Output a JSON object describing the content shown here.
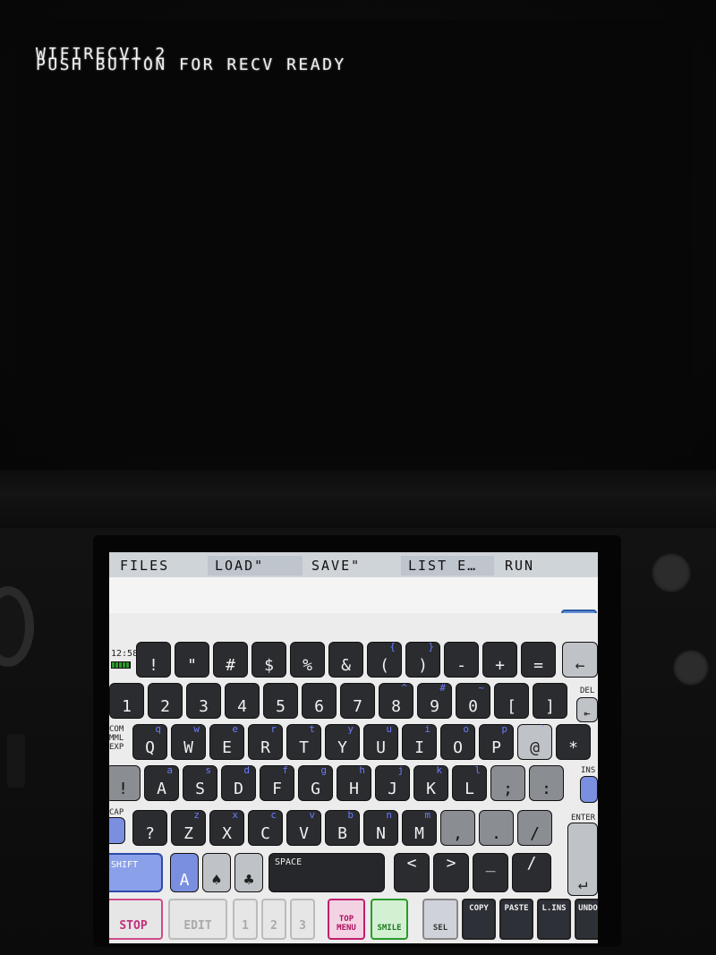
{
  "top_screen": {
    "line1": "WIFIRECV1.2",
    "line2": "PUSH BUTTON FOR RECV READY"
  },
  "menu": {
    "files": "FILES",
    "load": "LOAD\"",
    "save": "SAVE\"",
    "list": "LIST E…",
    "run": "RUN"
  },
  "status": {
    "clock": "12:58",
    "help": "?"
  },
  "side_labels": {
    "com": "COM",
    "mml": "MML",
    "exp": "EXP",
    "ins": "INS",
    "cap": "CAP",
    "del": "DEL",
    "enter": "ENTER"
  },
  "keys": {
    "row0": [
      "!",
      "\"",
      "#",
      "$",
      "%",
      "&",
      "(",
      ")",
      "-",
      "+",
      "="
    ],
    "row0_sub": [
      "",
      "",
      "",
      "",
      "",
      "",
      "{",
      "}",
      "",
      "",
      ""
    ],
    "row1": [
      "1",
      "2",
      "3",
      "4",
      "5",
      "6",
      "7",
      "8",
      "9",
      "0",
      "[",
      "]"
    ],
    "row1_sub": [
      "",
      "",
      "",
      "",
      "",
      "",
      "",
      "^",
      "#",
      "~",
      "",
      ""
    ],
    "row2": [
      "Q",
      "W",
      "E",
      "R",
      "T",
      "Y",
      "U",
      "I",
      "O",
      "P",
      "@",
      "*"
    ],
    "row2_sub": [
      "q",
      "w",
      "e",
      "r",
      "t",
      "y",
      "u",
      "i",
      "o",
      "p",
      "`",
      ""
    ],
    "row3": [
      "!",
      "A",
      "S",
      "D",
      "F",
      "G",
      "H",
      "J",
      "K",
      "L",
      ";",
      ":"
    ],
    "row3_sub": [
      "",
      "a",
      "s",
      "d",
      "f",
      "g",
      "h",
      "j",
      "k",
      "l",
      "",
      ""
    ],
    "row4": [
      "?",
      "Z",
      "X",
      "C",
      "V",
      "B",
      "N",
      "M",
      ",",
      ".",
      "/"
    ],
    "row4_sub": [
      "",
      "z",
      "x",
      "c",
      "v",
      "b",
      "n",
      "m",
      "",
      "",
      ""
    ],
    "row5": {
      "shift": "SHIFT",
      "space": "SPACE",
      "left": "<",
      "right": ">",
      "underscore": "_",
      "slash": "/"
    }
  },
  "func_keys": {
    "stop": "STOP",
    "edit": "EDIT",
    "p1": "1",
    "p2": "2",
    "p3": "3",
    "top_menu": "TOP MENU",
    "smile": "SMILE",
    "sel": "SEL",
    "copy": "COPY",
    "paste": "PASTE",
    "lins": "L.INS",
    "undo": "UNDO"
  },
  "colors": {
    "accent_blue": "#6b7bff",
    "stop_pink": "#d04a8a",
    "smile_green": "#2a9a2a",
    "key_dark": "#2a2c2f",
    "help_blue": "#5e8fd8"
  }
}
